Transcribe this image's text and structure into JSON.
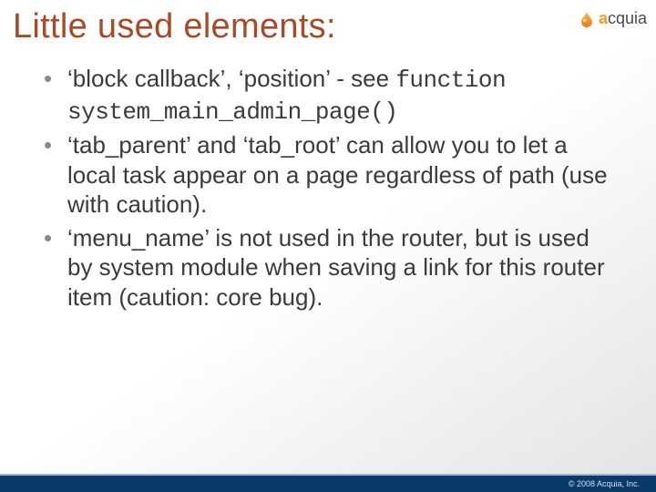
{
  "title": "Little used elements:",
  "logo": {
    "brand_prefix": "a",
    "brand_rest": "cquia"
  },
  "bullets": [
    {
      "text_a": "‘block callback’, ‘position’ - see ",
      "code_a": "function system_main_admin_page()"
    },
    {
      "text_a": "‘tab_parent’ and ‘tab_root’ can allow you to let a local task appear on a page regardless of path (use with caution)."
    },
    {
      "text_a": "‘menu_name’ is not used in the router, but is used by system module when saving a link for this router item (caution: core bug)."
    }
  ],
  "footer": {
    "copyright": "© 2008 Acquia, Inc."
  }
}
